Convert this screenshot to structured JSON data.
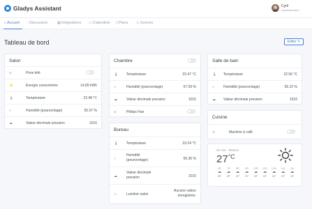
{
  "app": {
    "title": "Gladys Assistant"
  },
  "user": {
    "name": "Cyril",
    "role": "Administrateur"
  },
  "nav": [
    {
      "icon": "home-icon",
      "glyph": "⌂",
      "label": "Accueil",
      "active": true
    },
    {
      "icon": "chat-icon",
      "glyph": "◌",
      "label": "Discussion"
    },
    {
      "icon": "grid-icon",
      "glyph": "▦",
      "label": "Intégrations"
    },
    {
      "icon": "calendar-icon",
      "glyph": "▭",
      "label": "Calendrier"
    },
    {
      "icon": "map-icon",
      "glyph": "▯",
      "label": "Plans"
    },
    {
      "icon": "play-icon",
      "glyph": "▷",
      "label": "Scènes"
    }
  ],
  "page": {
    "title": "Tableau de bord",
    "edit_label": "Editer"
  },
  "cards": {
    "salon": {
      "title": "Salon",
      "rows": [
        {
          "icon": "plug-icon",
          "glyph": "⊂",
          "label": "Prise télé",
          "toggle": false
        },
        {
          "icon": "lightning-icon",
          "glyph": "⚡",
          "label": "Energie consommée",
          "value": "14.89 kWh"
        },
        {
          "icon": "thermometer-icon",
          "glyph": "🌡",
          "label": "Température",
          "value": "22.48 °C"
        },
        {
          "icon": "droplet-icon",
          "glyph": "○",
          "label": "Humidité (pourcentage)",
          "value": "55.07 %"
        },
        {
          "icon": "cloud-icon",
          "glyph": "☁",
          "label": "Valeur décimale pression",
          "value": "1016"
        }
      ]
    },
    "chambre": {
      "title": "Chambre",
      "rows": [
        {
          "icon": "thermometer-icon",
          "glyph": "🌡",
          "label": "Température",
          "value": "22.47 °C"
        },
        {
          "icon": "droplet-icon",
          "glyph": "○",
          "label": "Humidité (pourcentage)",
          "value": "57.59 %"
        },
        {
          "icon": "cloud-icon",
          "glyph": "☁",
          "label": "Valeur décimale pression",
          "value": "1015"
        },
        {
          "icon": "plug-icon",
          "glyph": "⊂",
          "label": "Philips Hue",
          "toggle": false
        }
      ]
    },
    "bureau": {
      "title": "Bureau",
      "rows": [
        {
          "icon": "thermometer-icon",
          "glyph": "🌡",
          "label": "Température",
          "value": "23.24 °C"
        },
        {
          "icon": "droplet-icon",
          "glyph": "○",
          "label": "Humidité (pourcentage)",
          "value": "55.36 %"
        },
        {
          "icon": "cloud-icon",
          "glyph": "☁",
          "label": "Valeur décimale pression",
          "value": "1015"
        },
        {
          "icon": "sun-icon",
          "glyph": "☼",
          "label": "Lumière salon",
          "value": "Aucune valeur enregistrée."
        }
      ]
    },
    "salle_de_bain": {
      "title": "Salle de bain",
      "rows": [
        {
          "icon": "thermometer-icon",
          "glyph": "🌡",
          "label": "Température",
          "value": "22.56 °C"
        },
        {
          "icon": "droplet-icon",
          "glyph": "○",
          "label": "Humidité (pourcentage)",
          "value": "56.22 %"
        },
        {
          "icon": "cloud-icon",
          "glyph": "☁",
          "label": "Valeur décimale pression",
          "value": "1016"
        }
      ]
    },
    "cuisine": {
      "title": "Cuisine",
      "rows": [
        {
          "icon": "plug-icon",
          "glyph": "⊂",
          "label": "Machine à café",
          "toggle": false
        }
      ]
    }
  },
  "weather": {
    "header": "30 mai - Maison",
    "temp": "27",
    "unit": "°C",
    "icon": "sun-icon",
    "forecast": [
      {
        "hour": "6PI",
        "temp": "26°"
      },
      {
        "hour": "7PI",
        "temp": "25°"
      },
      {
        "hour": "8PI",
        "temp": "22°"
      },
      {
        "hour": "9PI",
        "temp": "19°"
      },
      {
        "hour": "10PI",
        "temp": "18°"
      },
      {
        "hour": "11PI",
        "temp": "16°"
      },
      {
        "hour": "12AI",
        "temp": "16°"
      },
      {
        "hour": "1AI",
        "temp": "15°"
      },
      {
        "hour": "2AI",
        "temp": "15°"
      }
    ]
  }
}
